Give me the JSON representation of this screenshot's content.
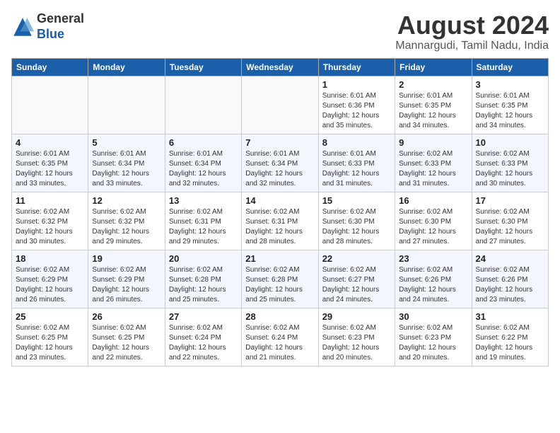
{
  "header": {
    "logo_line1": "General",
    "logo_line2": "Blue",
    "month_year": "August 2024",
    "location": "Mannargudi, Tamil Nadu, India"
  },
  "weekdays": [
    "Sunday",
    "Monday",
    "Tuesday",
    "Wednesday",
    "Thursday",
    "Friday",
    "Saturday"
  ],
  "weeks": [
    [
      {
        "day": "",
        "info": ""
      },
      {
        "day": "",
        "info": ""
      },
      {
        "day": "",
        "info": ""
      },
      {
        "day": "",
        "info": ""
      },
      {
        "day": "1",
        "info": "Sunrise: 6:01 AM\nSunset: 6:36 PM\nDaylight: 12 hours\nand 35 minutes."
      },
      {
        "day": "2",
        "info": "Sunrise: 6:01 AM\nSunset: 6:35 PM\nDaylight: 12 hours\nand 34 minutes."
      },
      {
        "day": "3",
        "info": "Sunrise: 6:01 AM\nSunset: 6:35 PM\nDaylight: 12 hours\nand 34 minutes."
      }
    ],
    [
      {
        "day": "4",
        "info": "Sunrise: 6:01 AM\nSunset: 6:35 PM\nDaylight: 12 hours\nand 33 minutes."
      },
      {
        "day": "5",
        "info": "Sunrise: 6:01 AM\nSunset: 6:34 PM\nDaylight: 12 hours\nand 33 minutes."
      },
      {
        "day": "6",
        "info": "Sunrise: 6:01 AM\nSunset: 6:34 PM\nDaylight: 12 hours\nand 32 minutes."
      },
      {
        "day": "7",
        "info": "Sunrise: 6:01 AM\nSunset: 6:34 PM\nDaylight: 12 hours\nand 32 minutes."
      },
      {
        "day": "8",
        "info": "Sunrise: 6:01 AM\nSunset: 6:33 PM\nDaylight: 12 hours\nand 31 minutes."
      },
      {
        "day": "9",
        "info": "Sunrise: 6:02 AM\nSunset: 6:33 PM\nDaylight: 12 hours\nand 31 minutes."
      },
      {
        "day": "10",
        "info": "Sunrise: 6:02 AM\nSunset: 6:33 PM\nDaylight: 12 hours\nand 30 minutes."
      }
    ],
    [
      {
        "day": "11",
        "info": "Sunrise: 6:02 AM\nSunset: 6:32 PM\nDaylight: 12 hours\nand 30 minutes."
      },
      {
        "day": "12",
        "info": "Sunrise: 6:02 AM\nSunset: 6:32 PM\nDaylight: 12 hours\nand 29 minutes."
      },
      {
        "day": "13",
        "info": "Sunrise: 6:02 AM\nSunset: 6:31 PM\nDaylight: 12 hours\nand 29 minutes."
      },
      {
        "day": "14",
        "info": "Sunrise: 6:02 AM\nSunset: 6:31 PM\nDaylight: 12 hours\nand 28 minutes."
      },
      {
        "day": "15",
        "info": "Sunrise: 6:02 AM\nSunset: 6:30 PM\nDaylight: 12 hours\nand 28 minutes."
      },
      {
        "day": "16",
        "info": "Sunrise: 6:02 AM\nSunset: 6:30 PM\nDaylight: 12 hours\nand 27 minutes."
      },
      {
        "day": "17",
        "info": "Sunrise: 6:02 AM\nSunset: 6:30 PM\nDaylight: 12 hours\nand 27 minutes."
      }
    ],
    [
      {
        "day": "18",
        "info": "Sunrise: 6:02 AM\nSunset: 6:29 PM\nDaylight: 12 hours\nand 26 minutes."
      },
      {
        "day": "19",
        "info": "Sunrise: 6:02 AM\nSunset: 6:29 PM\nDaylight: 12 hours\nand 26 minutes."
      },
      {
        "day": "20",
        "info": "Sunrise: 6:02 AM\nSunset: 6:28 PM\nDaylight: 12 hours\nand 25 minutes."
      },
      {
        "day": "21",
        "info": "Sunrise: 6:02 AM\nSunset: 6:28 PM\nDaylight: 12 hours\nand 25 minutes."
      },
      {
        "day": "22",
        "info": "Sunrise: 6:02 AM\nSunset: 6:27 PM\nDaylight: 12 hours\nand 24 minutes."
      },
      {
        "day": "23",
        "info": "Sunrise: 6:02 AM\nSunset: 6:26 PM\nDaylight: 12 hours\nand 24 minutes."
      },
      {
        "day": "24",
        "info": "Sunrise: 6:02 AM\nSunset: 6:26 PM\nDaylight: 12 hours\nand 23 minutes."
      }
    ],
    [
      {
        "day": "25",
        "info": "Sunrise: 6:02 AM\nSunset: 6:25 PM\nDaylight: 12 hours\nand 23 minutes."
      },
      {
        "day": "26",
        "info": "Sunrise: 6:02 AM\nSunset: 6:25 PM\nDaylight: 12 hours\nand 22 minutes."
      },
      {
        "day": "27",
        "info": "Sunrise: 6:02 AM\nSunset: 6:24 PM\nDaylight: 12 hours\nand 22 minutes."
      },
      {
        "day": "28",
        "info": "Sunrise: 6:02 AM\nSunset: 6:24 PM\nDaylight: 12 hours\nand 21 minutes."
      },
      {
        "day": "29",
        "info": "Sunrise: 6:02 AM\nSunset: 6:23 PM\nDaylight: 12 hours\nand 20 minutes."
      },
      {
        "day": "30",
        "info": "Sunrise: 6:02 AM\nSunset: 6:23 PM\nDaylight: 12 hours\nand 20 minutes."
      },
      {
        "day": "31",
        "info": "Sunrise: 6:02 AM\nSunset: 6:22 PM\nDaylight: 12 hours\nand 19 minutes."
      }
    ]
  ]
}
